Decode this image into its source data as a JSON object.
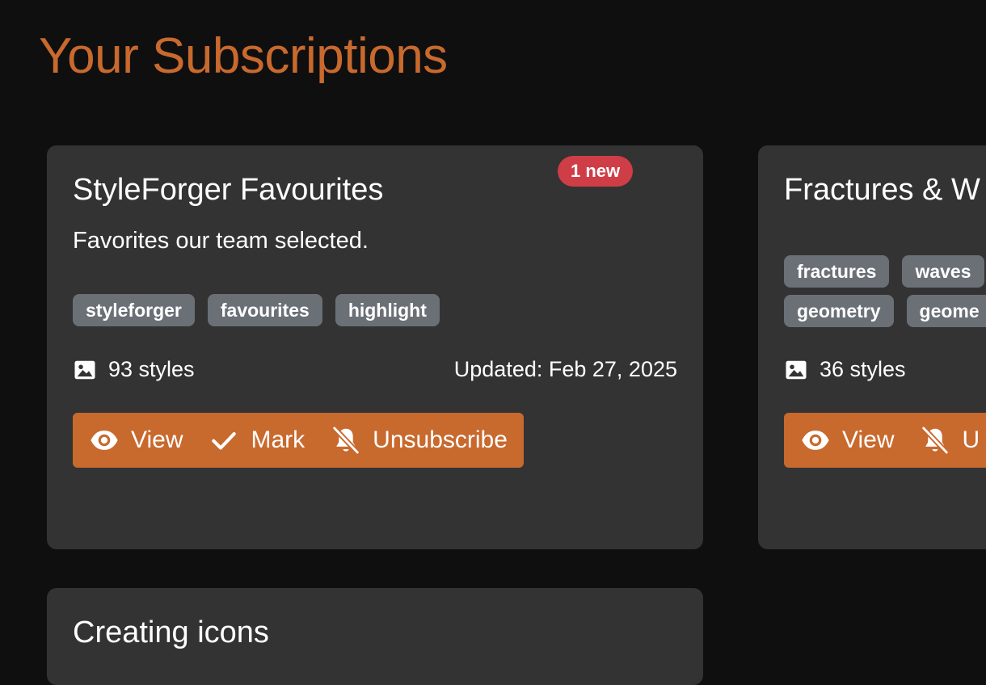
{
  "page": {
    "title": "Your Subscriptions"
  },
  "colors": {
    "accent": "#c8692e",
    "badge": "#cf3d46",
    "tag": "#6b7077",
    "card": "#333333",
    "background": "#0f0f0f"
  },
  "cards": [
    {
      "title": "StyleForger Favourites",
      "badge": "1 new",
      "description": "Favorites our team selected.",
      "tags": [
        "styleforger",
        "favourites",
        "highlight"
      ],
      "styles_count": "93 styles",
      "updated": "Updated: Feb 27, 2025",
      "actions": {
        "view": "View",
        "mark": "Mark",
        "unsubscribe": "Unsubscribe"
      }
    },
    {
      "title": "Fractures & W",
      "tags": [
        "fractures",
        "waves",
        "geometry",
        "geome"
      ],
      "styles_count": "36 styles",
      "actions": {
        "view": "View",
        "unsubscribe": "U"
      }
    },
    {
      "title": "Creating icons"
    }
  ],
  "icons": [
    "image-icon",
    "eye-icon",
    "check-icon",
    "bell-slash-icon"
  ]
}
